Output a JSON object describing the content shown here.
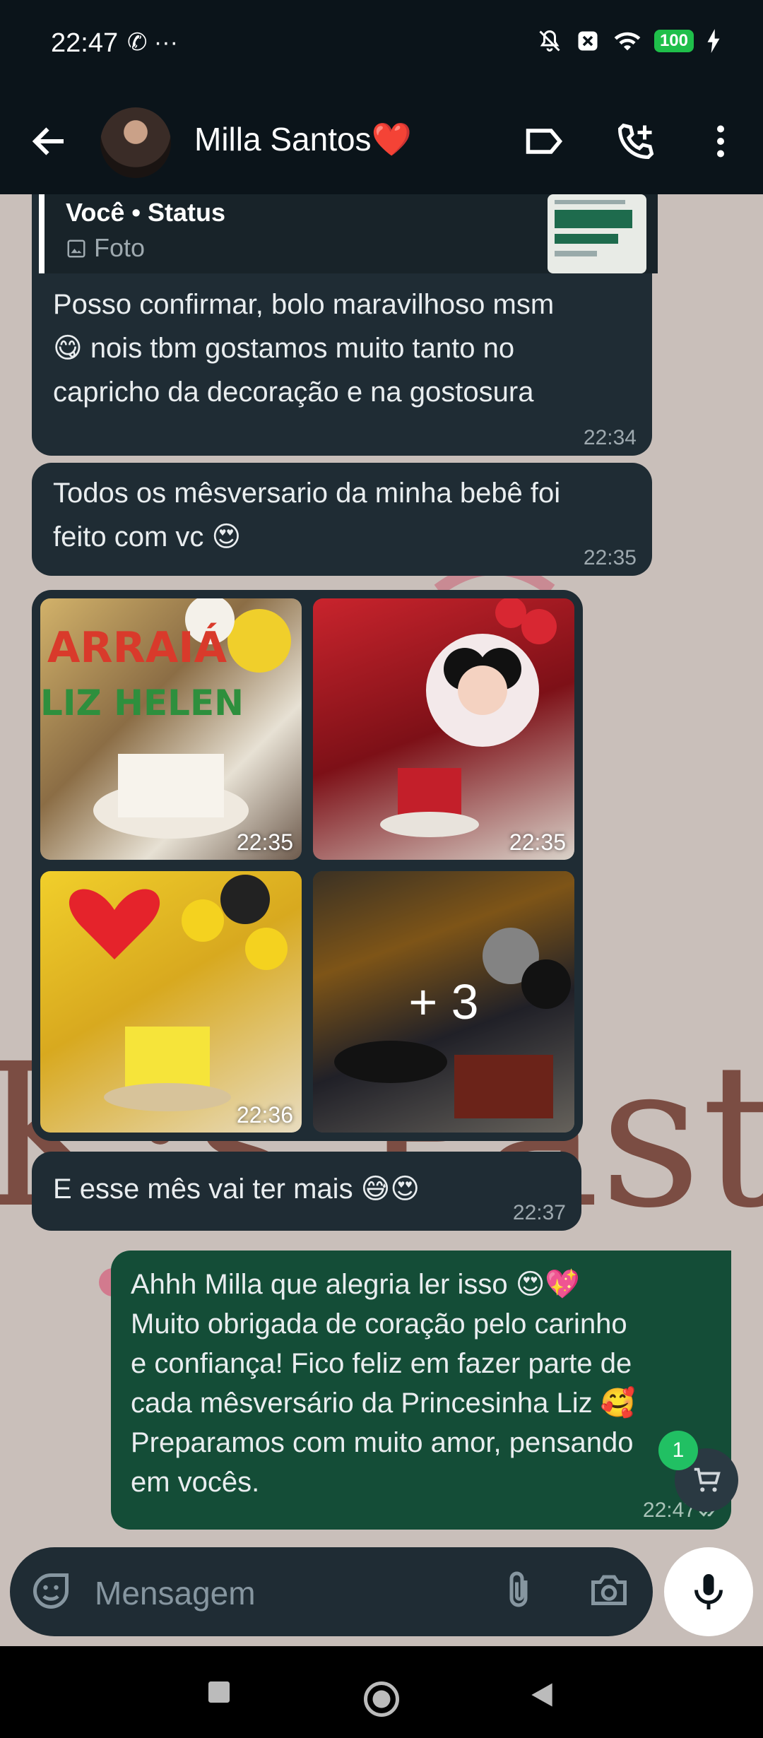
{
  "status_bar": {
    "time": "22:47",
    "left_icons": "✆ ···",
    "battery": "100"
  },
  "header": {
    "contact_name": "Milla Santos❤️"
  },
  "messages": {
    "reply": {
      "title": "Você • Status",
      "subtitle": "Foto"
    },
    "m1": {
      "line1": "Posso confirmar, bolo maravilhoso msm",
      "line2": "😋 nois tbm gostamos muito tanto no",
      "line3": "capricho da decoração e  na gostosura",
      "time": "22:34"
    },
    "m2": {
      "line1": "Todos os mêsversario da minha bebê foi",
      "line2": "feito com vc 😍",
      "time": "22:35"
    },
    "media": {
      "t1": "22:35",
      "t2": "22:35",
      "t3": "22:36",
      "more": "+ 3"
    },
    "m3": {
      "text": "E esse mês vai ter mais 😅😍",
      "time": "22:37"
    },
    "m4": {
      "line1": "Ahhh Milla que alegria ler isso 😍💖",
      "line2": "Muito obrigada de coração pelo carinho",
      "line3": "e confiança! Fico  feliz em fazer parte de",
      "line4": "cada mêsversário da Princesinha Liz 🥰",
      "line5": "Preparamos com muito amor, pensando",
      "line6": "em vocês.",
      "time": "22:47"
    }
  },
  "cart": {
    "badge": "1"
  },
  "composer": {
    "placeholder": "Mensagem"
  }
}
